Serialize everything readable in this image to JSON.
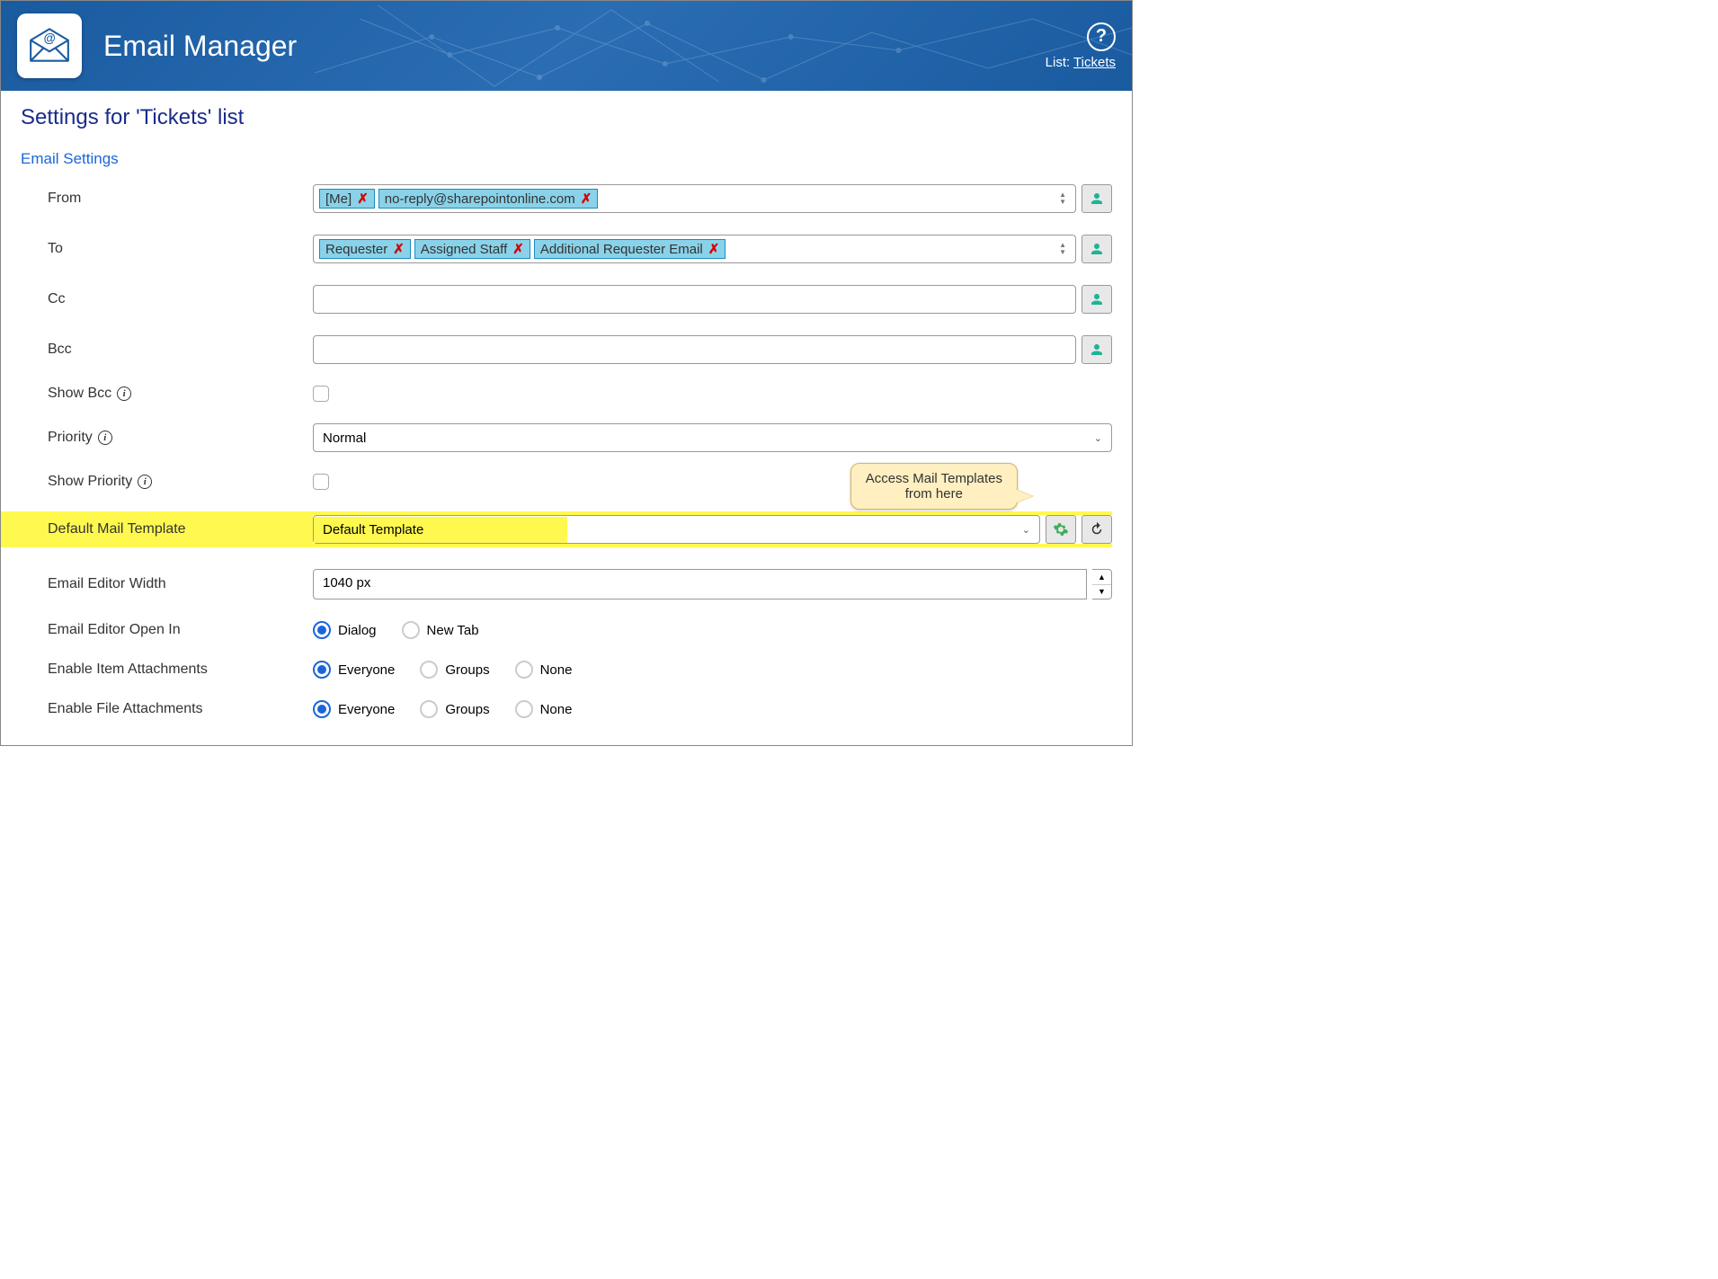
{
  "header": {
    "app_title": "Email Manager",
    "list_prefix": "List: ",
    "list_name": "Tickets"
  },
  "page_title": "Settings for 'Tickets' list",
  "section_title": "Email Settings",
  "labels": {
    "from": "From",
    "to": "To",
    "cc": "Cc",
    "bcc": "Bcc",
    "show_bcc": "Show Bcc",
    "priority": "Priority",
    "show_priority": "Show Priority",
    "default_template": "Default Mail Template",
    "editor_width": "Email Editor Width",
    "open_in": "Email Editor Open In",
    "item_attach": "Enable Item Attachments",
    "file_attach": "Enable File Attachments"
  },
  "from_tags": [
    "[Me]",
    "no-reply@sharepointonline.com"
  ],
  "to_tags": [
    "Requester",
    "Assigned Staff",
    "Additional Requester Email"
  ],
  "priority_value": "Normal",
  "template_value": "Default Template",
  "width_value": "1040 px",
  "open_in_options": [
    "Dialog",
    "New Tab"
  ],
  "open_in_selected": "Dialog",
  "attach_options": [
    "Everyone",
    "Groups",
    "None"
  ],
  "item_attach_selected": "Everyone",
  "file_attach_selected": "Everyone",
  "callout_line1": "Access Mail Templates",
  "callout_line2": "from here"
}
